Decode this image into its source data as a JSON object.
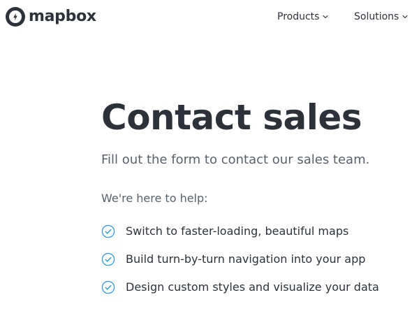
{
  "header": {
    "brand": "mapbox",
    "logo_icon": "mapbox-logo-icon",
    "nav": [
      {
        "label": "Products",
        "icon": "chevron-down-icon"
      },
      {
        "label": "Solutions",
        "icon": "chevron-down-icon"
      }
    ]
  },
  "main": {
    "title": "Contact sales",
    "subtitle": "Fill out the form to contact our sales team.",
    "help_heading": "We're here to help:",
    "features": [
      {
        "text": "Switch to faster-loading, beautiful maps",
        "icon": "check-circle-icon"
      },
      {
        "text": "Build turn-by-turn navigation into your app",
        "icon": "check-circle-icon"
      },
      {
        "text": "Design custom styles and visualize your data",
        "icon": "check-circle-icon"
      }
    ]
  },
  "colors": {
    "text_dark": "#2d323a",
    "text_muted": "#5a616b",
    "accent_blue": "#3f9ddb"
  }
}
